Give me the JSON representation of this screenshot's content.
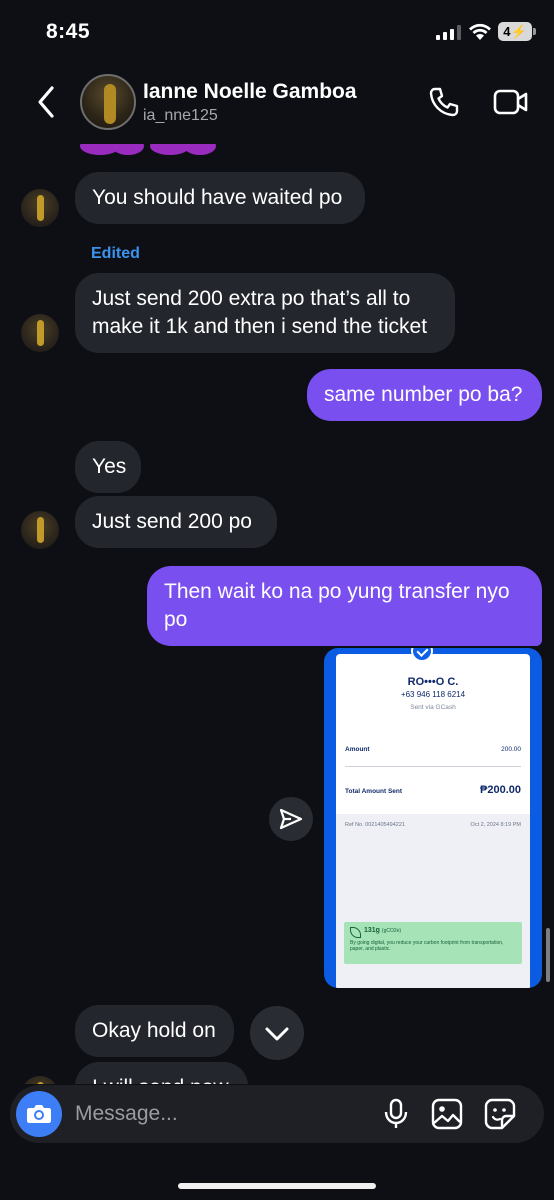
{
  "status_bar": {
    "time": "8:45",
    "battery": "4"
  },
  "header": {
    "contact_name": "Ianne Noelle Gamboa",
    "contact_handle": "ia_nne125",
    "icons": [
      "back-arrow",
      "call-icon",
      "video-icon"
    ]
  },
  "messages": [
    {
      "from": "contact",
      "text": "You should have waited po"
    },
    {
      "from": "contact",
      "edited_label": "Edited",
      "text": "Just send 200 extra po that’s all to make it 1k and then i send the ticket"
    },
    {
      "from": "me",
      "text": "same number po ba?"
    },
    {
      "from": "contact",
      "text": "Yes"
    },
    {
      "from": "contact",
      "text": "Just send 200 po"
    },
    {
      "from": "me",
      "text": "Then wait ko na po yung transfer nyo po"
    },
    {
      "from": "contact",
      "text": "Okay hold on"
    },
    {
      "from": "contact",
      "text": "I will send now"
    }
  ],
  "receipt": {
    "recipient": "RO•••O C.",
    "phone": "+63 946 118 6214",
    "sent_via": "Sent via GCash",
    "amount_label": "Amount",
    "amount_value": "200.00",
    "total_label": "Total Amount Sent",
    "total_value": "₱200.00",
    "ref_label": "Ref No. 0021405494221",
    "ref_date": "Oct 2, 2024 8:19 PM",
    "carbon_grams": "131g",
    "carbon_unit": "(gCO2e)",
    "carbon_note": "By going digital, you reduce your carbon footprint from transportation, paper, and plastic."
  },
  "composer": {
    "placeholder": "Message..."
  },
  "colors": {
    "background": "#0d0f14",
    "incoming_bubble": "#24262d",
    "outgoing_bubble": "#7a4ff0",
    "edited_label": "#3b93f0",
    "camera_button": "#3d7ef6"
  }
}
